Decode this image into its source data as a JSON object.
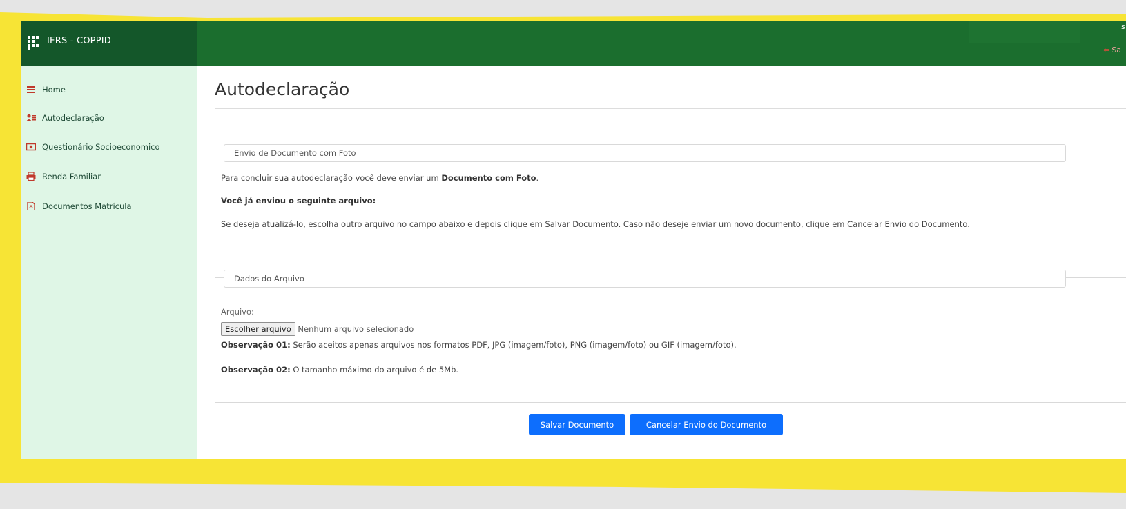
{
  "colors": {
    "frame_yellow": "#f7e435",
    "topbar_green": "#1b6e2e",
    "brand_green": "#14572a",
    "sidebar_bg": "#dff6e6",
    "button_blue": "#0d6efd",
    "logout_red": "#e24b3c"
  },
  "header": {
    "brand": "IFRS - COPPID",
    "logout_label": "Sa",
    "top_right_glyph": "s"
  },
  "sidebar": {
    "items": [
      {
        "label": "Home",
        "icon": "list-icon"
      },
      {
        "label": "Autodeclaração",
        "icon": "users-icon"
      },
      {
        "label": "Questionário Socioeconomico",
        "icon": "money-icon"
      },
      {
        "label": "Renda Familiar",
        "icon": "printer-icon"
      },
      {
        "label": "Documentos Matrícula",
        "icon": "document-icon"
      }
    ]
  },
  "main": {
    "title": "Autodeclaração",
    "panel1": {
      "legend": "Envio de Documento com Foto",
      "line1_pre": "Para concluir sua autodeclaração você deve enviar um ",
      "line1_bold": "Documento com Foto",
      "line1_post": ".",
      "line2_bold": "Você já enviou o seguinte arquivo:",
      "line3": "Se deseja atualizá-lo, escolha outro arquivo no campo abaixo e depois clique em Salvar Documento. Caso não deseje enviar um novo documento, clique em Cancelar Envio do Documento."
    },
    "panel2": {
      "legend": "Dados do Arquivo",
      "file_label": "Arquivo:",
      "file_button": "Escolher arquivo",
      "file_status": "Nenhum arquivo selecionado",
      "obs1_bold": "Observação 01:",
      "obs1_text": " Serão aceitos apenas arquivos nos formatos PDF, JPG (imagem/foto), PNG (imagem/foto) ou GIF (imagem/foto).",
      "obs2_bold": "Observação 02:",
      "obs2_text": " O tamanho máximo do arquivo é de 5Mb."
    },
    "buttons": {
      "save": "Salvar Documento",
      "cancel": "Cancelar Envio do Documento"
    }
  }
}
